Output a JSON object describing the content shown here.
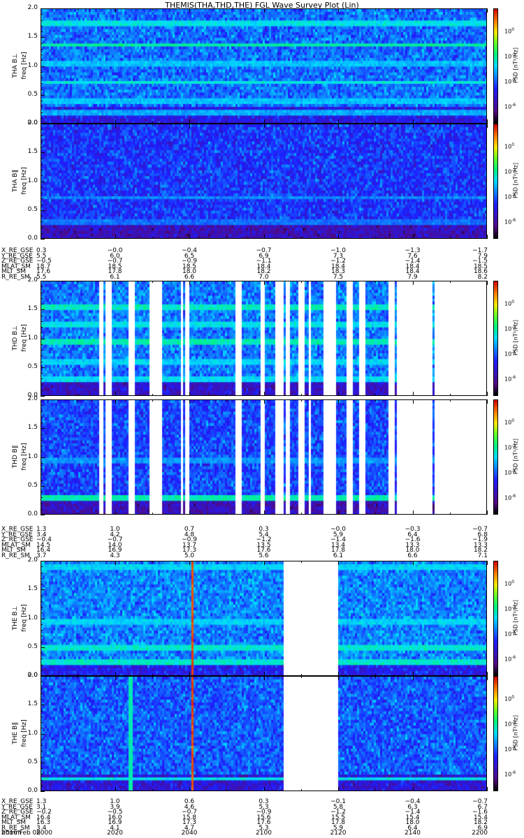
{
  "title": "THEMIS(THA,THD,THE) FGL Wave Survey Plot (Lin)",
  "date": "2016 Feb 08",
  "time_axis": {
    "start_hhmm": "2000",
    "end_hhmm": "2200",
    "span_minutes": 120,
    "major_tick_minutes": 20,
    "minor_tick_minutes": 10
  },
  "colorbar": {
    "label": "PSD [nT²/Hz]",
    "log_min": -7.3,
    "log_max": 1.8,
    "ticks": [
      {
        "exp": "0",
        "value": 0
      },
      {
        "exp": "-2",
        "value": -2
      },
      {
        "exp": "-4",
        "value": -4
      },
      {
        "exp": "-6",
        "value": -6
      }
    ]
  },
  "freq_axis": {
    "label": "freq [Hz]",
    "ticks": [
      "0.0",
      "0.5",
      "1.0",
      "1.5",
      "2.0"
    ],
    "range": [
      0,
      2
    ]
  },
  "chart_data": [
    {
      "type": "heatmap",
      "name": "THA B⊥",
      "ylabel": "THA B⊥",
      "base": -3.8,
      "low_base": -4.9,
      "coverage": [
        [
          0,
          120
        ]
      ],
      "bands": [
        [
          1.37,
          -2.1
        ],
        [
          1.75,
          -2.6
        ],
        [
          1.05,
          -3.0
        ],
        [
          0.72,
          -2.5
        ],
        [
          0.4,
          -3.0
        ],
        [
          0.2,
          -3.2
        ]
      ],
      "vlines": []
    },
    {
      "type": "heatmap",
      "name": "THA B∥",
      "ylabel": "THA B∥",
      "base": -4.4,
      "low_base": -5.6,
      "coverage": [
        [
          0,
          120
        ]
      ],
      "bands": [
        [
          0.72,
          -3.6
        ],
        [
          0.3,
          -3.8
        ]
      ],
      "vlines": []
    },
    {
      "type": "heatmap",
      "name": "THD B⊥",
      "ylabel": "THD B⊥",
      "base": -3.7,
      "low_base": -5.4,
      "coverage": [
        [
          0,
          15.4
        ],
        [
          16.5,
          17.3
        ],
        [
          18.8,
          23.1
        ],
        [
          24.8,
          28.9
        ],
        [
          32.3,
          37.2
        ],
        [
          38.3,
          38.7
        ],
        [
          39.8,
          52
        ],
        [
          53.7,
          58.8
        ],
        [
          60.1,
          62.7
        ],
        [
          65,
          65.5
        ],
        [
          66.7,
          68.9
        ],
        [
          70.8,
          71.7
        ],
        [
          72.5,
          75.7
        ],
        [
          78.9,
          82.1
        ],
        [
          83.4,
          85.6
        ],
        [
          86.9,
          93.3
        ],
        [
          94.9,
          95.6
        ],
        [
          105.2,
          105.5
        ]
      ],
      "bands": [
        [
          1.55,
          -2.3
        ],
        [
          1.25,
          -2.6
        ],
        [
          0.95,
          -2.2
        ],
        [
          0.6,
          -2.8
        ],
        [
          0.3,
          -2.7
        ]
      ],
      "vlines": []
    },
    {
      "type": "heatmap",
      "name": "THD B∥",
      "ylabel": "THD B∥",
      "base": -4.2,
      "low_base": -5.6,
      "coverage": [
        [
          0,
          15.4
        ],
        [
          16.5,
          17.3
        ],
        [
          18.8,
          23.1
        ],
        [
          24.8,
          28.9
        ],
        [
          32.3,
          37.2
        ],
        [
          38.3,
          38.7
        ],
        [
          39.8,
          52
        ],
        [
          53.7,
          58.8
        ],
        [
          60.1,
          62.7
        ],
        [
          65,
          65.5
        ],
        [
          66.7,
          68.9
        ],
        [
          70.8,
          71.7
        ],
        [
          72.5,
          75.7
        ],
        [
          78.9,
          82.1
        ],
        [
          83.4,
          85.6
        ],
        [
          86.9,
          93.3
        ],
        [
          94.9,
          95.6
        ],
        [
          105.2,
          105.5
        ]
      ],
      "bands": [
        [
          0.3,
          -2.2
        ],
        [
          0.95,
          -3.4
        ]
      ],
      "vlines": []
    },
    {
      "type": "heatmap",
      "name": "THE B⊥",
      "ylabel": "THE B⊥",
      "base": -3.6,
      "low_base": -4.8,
      "coverage": [
        [
          0,
          64.8
        ],
        [
          79.8,
          120
        ]
      ],
      "bands": [
        [
          0.5,
          -2.4
        ],
        [
          0.25,
          -2.4
        ],
        [
          0.95,
          -2.8
        ],
        [
          1.9,
          -2.8
        ]
      ],
      "vlines": [
        [
          40.6,
          1.2
        ]
      ]
    },
    {
      "type": "heatmap",
      "name": "THE B∥",
      "ylabel": "THE B∥",
      "base": -4.0,
      "low_base": -5.2,
      "coverage": [
        [
          0,
          64.8
        ],
        [
          79.8,
          120
        ]
      ],
      "bands": [
        [
          0.22,
          -2.6
        ]
      ],
      "vlines": [
        [
          40.6,
          1.2
        ],
        [
          23.8,
          -2.2
        ]
      ]
    }
  ],
  "ephemeris": [
    {
      "rows": [
        {
          "name": "X_RE_GSE",
          "values": [
            "0.3",
            "−0.0",
            "−0.4",
            "−0.7",
            "−1.0",
            "−1.3",
            "−1.7"
          ]
        },
        {
          "name": "Y_RE_GSE",
          "values": [
            "5.5",
            "6.0",
            "6.5",
            "6.9",
            "7.3",
            "7.6",
            "7.9"
          ]
        },
        {
          "name": "Z_RE_GSE",
          "values": [
            "−0.5",
            "−0.7",
            "−0.9",
            "−1.1",
            "−1.2",
            "−1.4",
            "−1.5"
          ]
        },
        {
          "name": "MLAT_SM",
          "values": [
            "18.7",
            "18.5",
            "18.5",
            "18.4",
            "18.4",
            "18.4",
            "18.5"
          ]
        },
        {
          "name": "MLT_SM",
          "values": [
            "17.6",
            "17.8",
            "18.0",
            "18.2",
            "18.3",
            "18.4",
            "18.6"
          ]
        },
        {
          "name": "R_RE_SM",
          "values": [
            "5.5",
            "6.1",
            "6.6",
            "7.0",
            "7.5",
            "7.9",
            "8.2"
          ]
        }
      ]
    },
    {
      "rows": [
        {
          "name": "X_RE_GSE",
          "values": [
            "1.3",
            "1.0",
            "0.7",
            "0.3",
            "−0.0",
            "−0.3",
            "−0.7"
          ]
        },
        {
          "name": "Y_RE_GSE",
          "values": [
            "3.4",
            "4.2",
            "4.8",
            "5.4",
            "5.9",
            "6.4",
            "6.8"
          ]
        },
        {
          "name": "Z_RE_GSE",
          "values": [
            "−0.4",
            "−0.7",
            "−0.9",
            "−1.2",
            "−1.4",
            "−1.6",
            "−1.9"
          ]
        },
        {
          "name": "MLAT_SM",
          "values": [
            "14.5",
            "14.0",
            "13.7",
            "13.5",
            "13.4",
            "13.3",
            "13.3"
          ]
        },
        {
          "name": "MLT_SM",
          "values": [
            "16.4",
            "16.9",
            "17.3",
            "17.6",
            "17.8",
            "18.0",
            "18.2"
          ]
        },
        {
          "name": "R_RE_SM",
          "values": [
            "3.7",
            "4.3",
            "5.0",
            "5.6",
            "6.1",
            "6.6",
            "7.1"
          ]
        }
      ]
    },
    {
      "rows": [
        {
          "name": "X_RE_GSE",
          "values": [
            "1.3",
            "1.0",
            "0.6",
            "0.3",
            "−0.1",
            "−0.4",
            "−0.7"
          ]
        },
        {
          "name": "Y_RE_GSE",
          "values": [
            "3.1",
            "3.9",
            "4.6",
            "5.3",
            "5.8",
            "6.3",
            "6.7"
          ]
        },
        {
          "name": "Z_RE_GSE",
          "values": [
            "−0.2",
            "−0.5",
            "−0.7",
            "−0.9",
            "−1.2",
            "−1.4",
            "−1.6"
          ]
        },
        {
          "name": "MLAT_SM",
          "values": [
            "16.4",
            "16.0",
            "15.8",
            "15.6",
            "15.5",
            "15.4",
            "15.4"
          ]
        },
        {
          "name": "MLT_SM",
          "values": [
            "16.3",
            "16.9",
            "17.3",
            "17.6",
            "17.8",
            "18.0",
            "18.2"
          ]
        },
        {
          "name": "R_RE_SM",
          "values": [
            "3.4",
            "4.1",
            "4.7",
            "5.3",
            "5.9",
            "6.4",
            "6.9"
          ]
        },
        {
          "name": "hhmm",
          "values": [
            "2000",
            "2020",
            "2040",
            "2100",
            "2120",
            "2140",
            "2200"
          ]
        }
      ]
    }
  ]
}
